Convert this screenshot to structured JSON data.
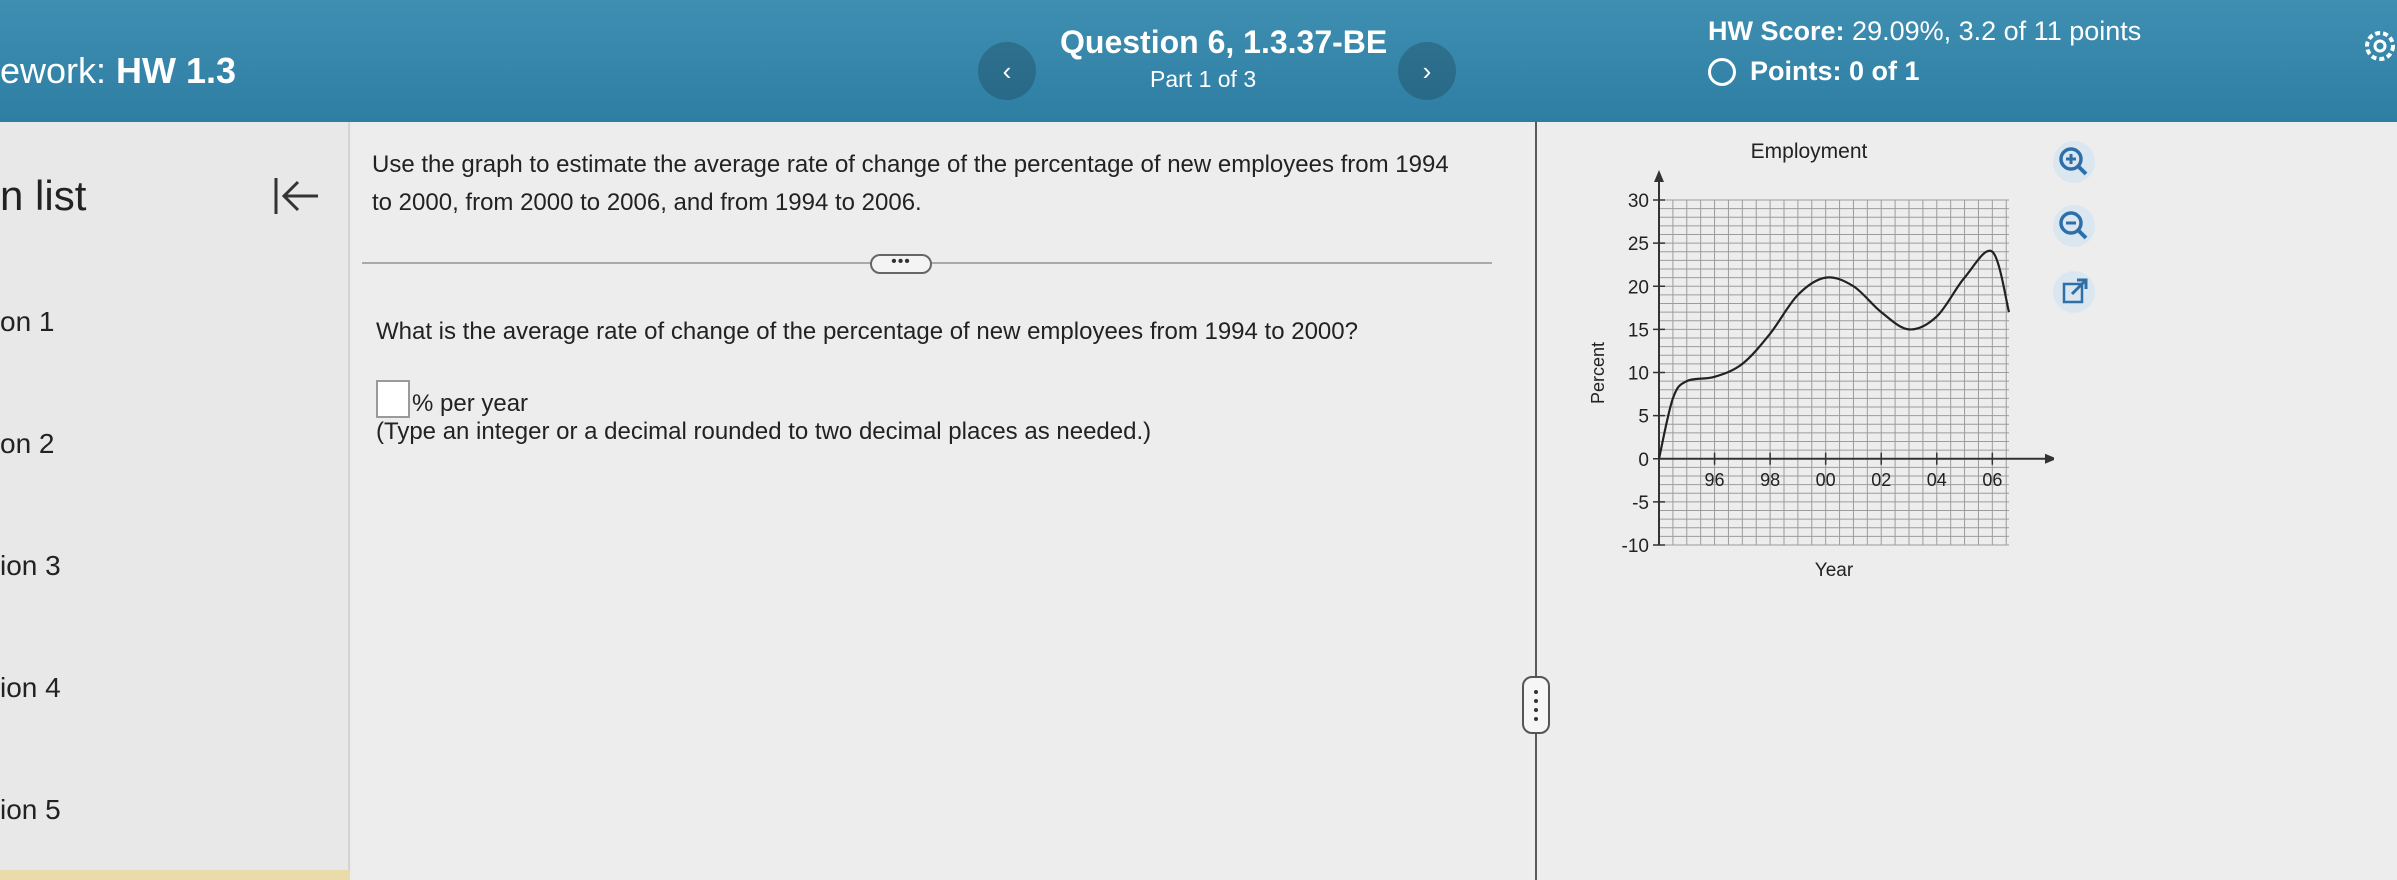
{
  "header": {
    "hw_prefix": "ework:",
    "hw_title": "HW 1.3",
    "prev_label": "‹",
    "next_label": "›",
    "question_title": "Question 6, 1.3.37-BE",
    "question_part": "Part 1 of 3",
    "score_label": "HW Score:",
    "score_value": "29.09%, 3.2 of 11 points",
    "points_label": "Points: 0 of 1"
  },
  "sidebar": {
    "heading": "n list",
    "items": [
      {
        "label": "on 1"
      },
      {
        "label": "on 2"
      },
      {
        "label": "ion 3"
      },
      {
        "label": "ion 4"
      },
      {
        "label": "ion 5"
      }
    ]
  },
  "problem": {
    "statement": "Use the graph to estimate the average rate of change of the percentage of new employees from 1994 to 2000, from 2000 to 2006, and from 1994 to 2006.",
    "more_label": "•••",
    "question": "What is the average rate of change of the percentage of new employees from 1994 to 2000?",
    "answer_value": "",
    "unit": "% per year",
    "hint": "(Type an integer or a decimal rounded to two decimal places as needed.)"
  },
  "chart_data": {
    "type": "line",
    "title": "Employment",
    "xlabel": "Year",
    "ylabel": "Percent",
    "ylim": [
      -10,
      30
    ],
    "xlim": [
      1994,
      2006.6
    ],
    "y_ticks": [
      "30",
      "25",
      "20",
      "15",
      "10",
      "5",
      "0",
      "-5",
      "-10"
    ],
    "x_ticks": [
      "96",
      "98",
      "00",
      "02",
      "04",
      "06"
    ],
    "grid": true,
    "series": [
      {
        "x": [
          1994,
          1994.5,
          1995,
          1996,
          1997,
          1998,
          1999,
          2000,
          2001,
          2002,
          2003,
          2004,
          2005,
          2006,
          2006.6
        ],
        "y": [
          0,
          7,
          9,
          9.5,
          11,
          14.5,
          19,
          21,
          20,
          17,
          15,
          16.5,
          21,
          24,
          17
        ]
      }
    ]
  },
  "tools": {
    "zoom_in": "zoom-in-icon",
    "zoom_out": "zoom-out-icon",
    "popout": "external-link-icon"
  },
  "colors": {
    "header_bg": "#3a8db0",
    "link_blue": "#2e6fa8"
  }
}
